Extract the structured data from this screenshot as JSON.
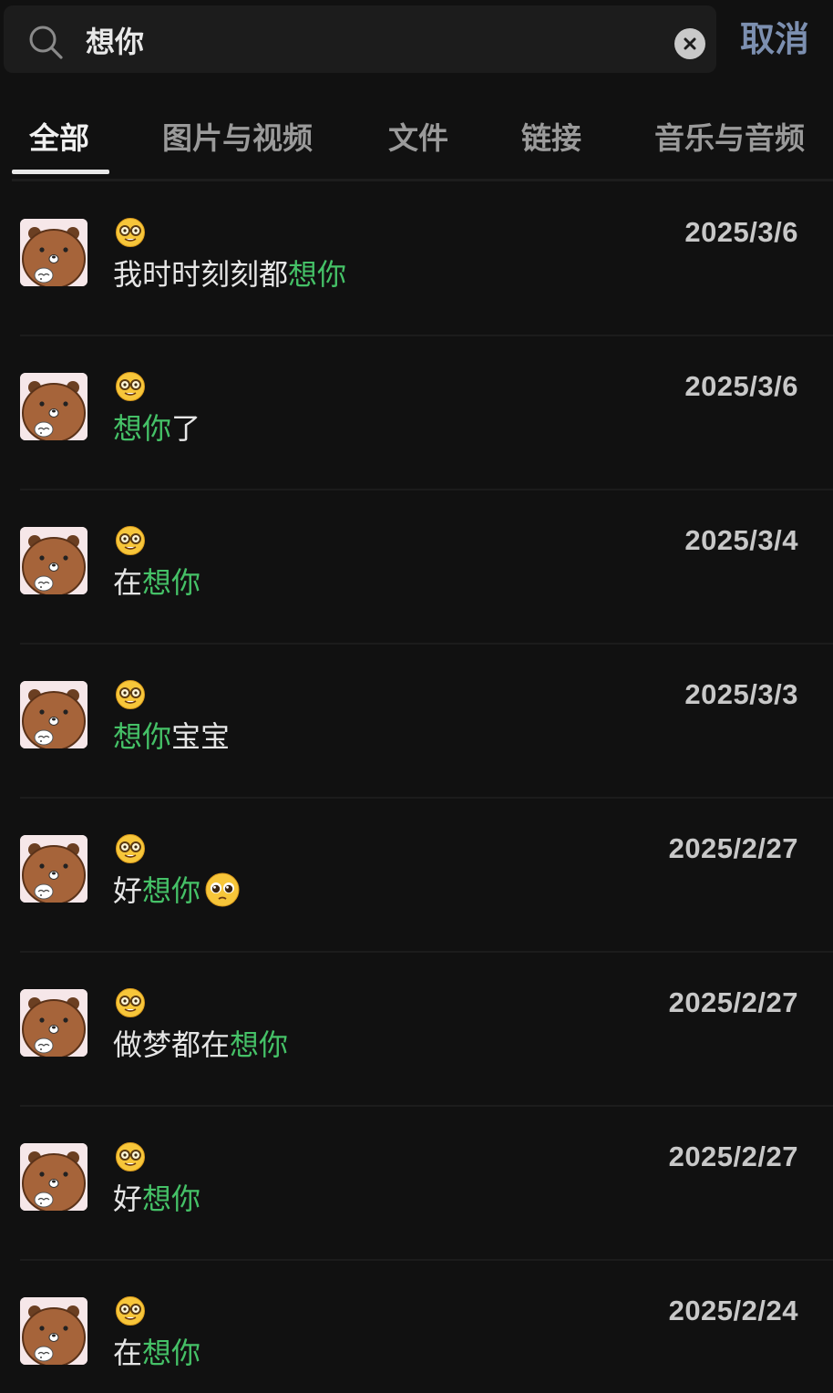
{
  "search": {
    "value": "想你",
    "cancel_label": "取消"
  },
  "tabs": [
    {
      "label": "全部",
      "active": true
    },
    {
      "label": "图片与视频",
      "active": false
    },
    {
      "label": "文件",
      "active": false
    },
    {
      "label": "链接",
      "active": false
    },
    {
      "label": "音乐与音频",
      "active": false
    }
  ],
  "results": [
    {
      "sender_icon": "nerd-face-emoji",
      "date": "2025/3/6",
      "message": [
        {
          "text": "我时时刻刻都",
          "hl": false
        },
        {
          "text": "想你",
          "hl": true
        }
      ]
    },
    {
      "sender_icon": "nerd-face-emoji",
      "date": "2025/3/6",
      "message": [
        {
          "text": "想你",
          "hl": true
        },
        {
          "text": "了",
          "hl": false
        }
      ]
    },
    {
      "sender_icon": "nerd-face-emoji",
      "date": "2025/3/4",
      "message": [
        {
          "text": "在",
          "hl": false
        },
        {
          "text": "想你",
          "hl": true
        }
      ]
    },
    {
      "sender_icon": "nerd-face-emoji",
      "date": "2025/3/3",
      "message": [
        {
          "text": "想你",
          "hl": true
        },
        {
          "text": "宝宝",
          "hl": false
        }
      ]
    },
    {
      "sender_icon": "nerd-face-emoji",
      "date": "2025/2/27",
      "message": [
        {
          "text": "好",
          "hl": false
        },
        {
          "text": "想你",
          "hl": true
        }
      ],
      "trailing_emoji": "pleading-face-emoji"
    },
    {
      "sender_icon": "nerd-face-emoji",
      "date": "2025/2/27",
      "message": [
        {
          "text": "做梦都在",
          "hl": false
        },
        {
          "text": "想你",
          "hl": true
        }
      ]
    },
    {
      "sender_icon": "nerd-face-emoji",
      "date": "2025/2/27",
      "message": [
        {
          "text": "好",
          "hl": false
        },
        {
          "text": "想你",
          "hl": true
        }
      ]
    },
    {
      "sender_icon": "nerd-face-emoji",
      "date": "2025/2/24",
      "message": [
        {
          "text": "在",
          "hl": false
        },
        {
          "text": "想你",
          "hl": true
        }
      ]
    }
  ],
  "colors": {
    "highlight": "#45c167",
    "cancel": "#7c8fb0",
    "background": "#111111"
  }
}
